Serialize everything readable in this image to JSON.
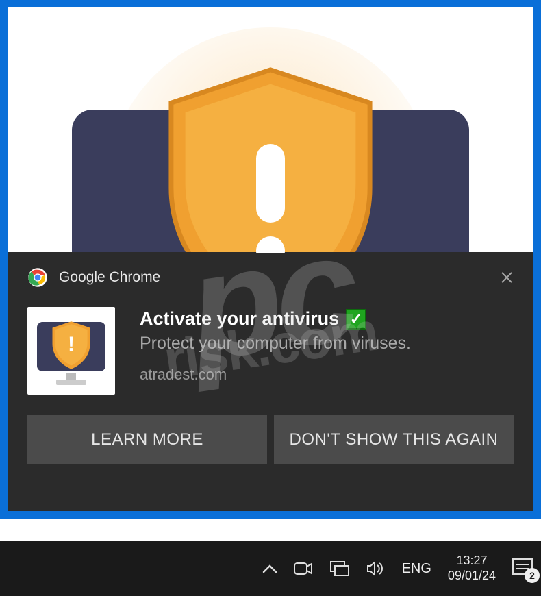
{
  "hero": {
    "icon_name": "shield-warning-monitor"
  },
  "notification": {
    "app_name": "Google Chrome",
    "title": "Activate your antivirus",
    "checkmark": "✓",
    "subtitle": "Protect your computer from viruses.",
    "domain": "atradest.com",
    "actions": {
      "learn_more": "LEARN MORE",
      "dismiss": "DON'T SHOW THIS AGAIN"
    }
  },
  "taskbar": {
    "language": "ENG",
    "time": "13:27",
    "date": "09/01/24",
    "action_center_count": "2"
  },
  "watermark": {
    "main": "pc",
    "sub": "risk.com"
  }
}
